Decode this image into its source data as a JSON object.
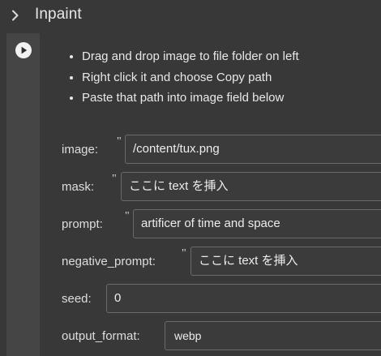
{
  "section": {
    "title": "Inpaint",
    "toggle_icon": "chevron-right-icon"
  },
  "cell": {
    "run_icon": "play-circle-icon",
    "instructions": [
      "Drag and drop image to file folder on left",
      "Right click it and choose Copy path",
      "Paste that path into image field below"
    ],
    "form": {
      "image": {
        "label": "image:",
        "quote": "\"",
        "value": "/content/tux.png"
      },
      "mask": {
        "label": "mask:",
        "quote": "\"",
        "value": "ここに text を挿入"
      },
      "prompt": {
        "label": "prompt:",
        "quote": "\"",
        "value": "artificer of time and space"
      },
      "negative_prompt": {
        "label": "negative_prompt:",
        "quote": "\"",
        "value": "ここに text を挿入"
      },
      "seed": {
        "label": "seed:",
        "value": "0"
      },
      "output_format": {
        "label": "output_format:",
        "value": "webp"
      }
    }
  },
  "colors": {
    "background": "#383838",
    "gutter": "#454545",
    "field_border": "#6a6a6a",
    "text": "#e8e8e8"
  }
}
